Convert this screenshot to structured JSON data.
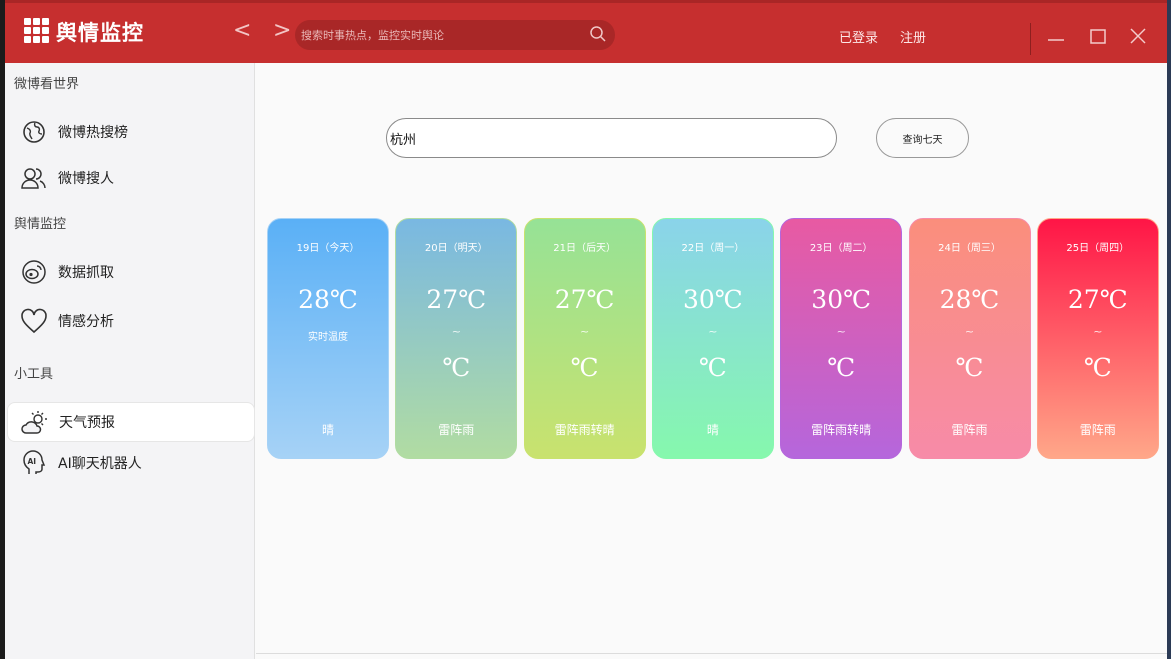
{
  "app": {
    "title": "舆情监控"
  },
  "nav": {
    "back": "<",
    "forward": ">"
  },
  "search": {
    "placeholder": "搜索时事热点，监控实时舆论"
  },
  "account": {
    "login": "已登录",
    "register": "注册"
  },
  "sidebar": {
    "sections": [
      {
        "title": "微博看世界",
        "items": [
          {
            "label": "微博热搜榜",
            "icon": "globe-icon"
          },
          {
            "label": "微博搜人",
            "icon": "users-icon"
          }
        ]
      },
      {
        "title": "舆情监控",
        "items": [
          {
            "label": "数据抓取",
            "icon": "weibo-icon"
          },
          {
            "label": "情感分析",
            "icon": "heart-icon"
          }
        ]
      },
      {
        "title": "小工具",
        "items": [
          {
            "label": "天气预报",
            "icon": "weather-icon",
            "active": true
          },
          {
            "label": "AI聊天机器人",
            "icon": "ai-head-icon"
          }
        ]
      }
    ]
  },
  "weather": {
    "city_value": "杭州",
    "query_button": "查询七天",
    "days": [
      {
        "date": "19日（今天）",
        "temp": "28℃",
        "sub": "实时温度",
        "low": "",
        "condition": "晴",
        "colors": [
          "#5ab0f6",
          "#a6d2f6"
        ]
      },
      {
        "date": "20日（明天）",
        "temp": "27℃",
        "sub": "~",
        "low": "℃",
        "condition": "雷阵雨",
        "colors": [
          "#79b8e2",
          "#b1dca2"
        ]
      },
      {
        "date": "21日（后天）",
        "temp": "27℃",
        "sub": "~",
        "low": "℃",
        "condition": "雷阵雨转晴",
        "colors": [
          "#96e296",
          "#c9e26e"
        ]
      },
      {
        "date": "22日（周一）",
        "temp": "30℃",
        "sub": "~",
        "low": "℃",
        "condition": "晴",
        "colors": [
          "#8ad3ea",
          "#86f8ad"
        ]
      },
      {
        "date": "23日（周二）",
        "temp": "30℃",
        "sub": "~",
        "low": "℃",
        "condition": "雷阵雨转晴",
        "colors": [
          "#e85aa2",
          "#b566dc"
        ]
      },
      {
        "date": "24日（周三）",
        "temp": "28℃",
        "sub": "~",
        "low": "℃",
        "condition": "雷阵雨",
        "colors": [
          "#fa8e7c",
          "#f78ba8"
        ]
      },
      {
        "date": "25日（周四）",
        "temp": "27℃",
        "sub": "~",
        "low": "℃",
        "condition": "雷阵雨",
        "colors": [
          "#ff1546",
          "#ffa789"
        ]
      }
    ]
  }
}
